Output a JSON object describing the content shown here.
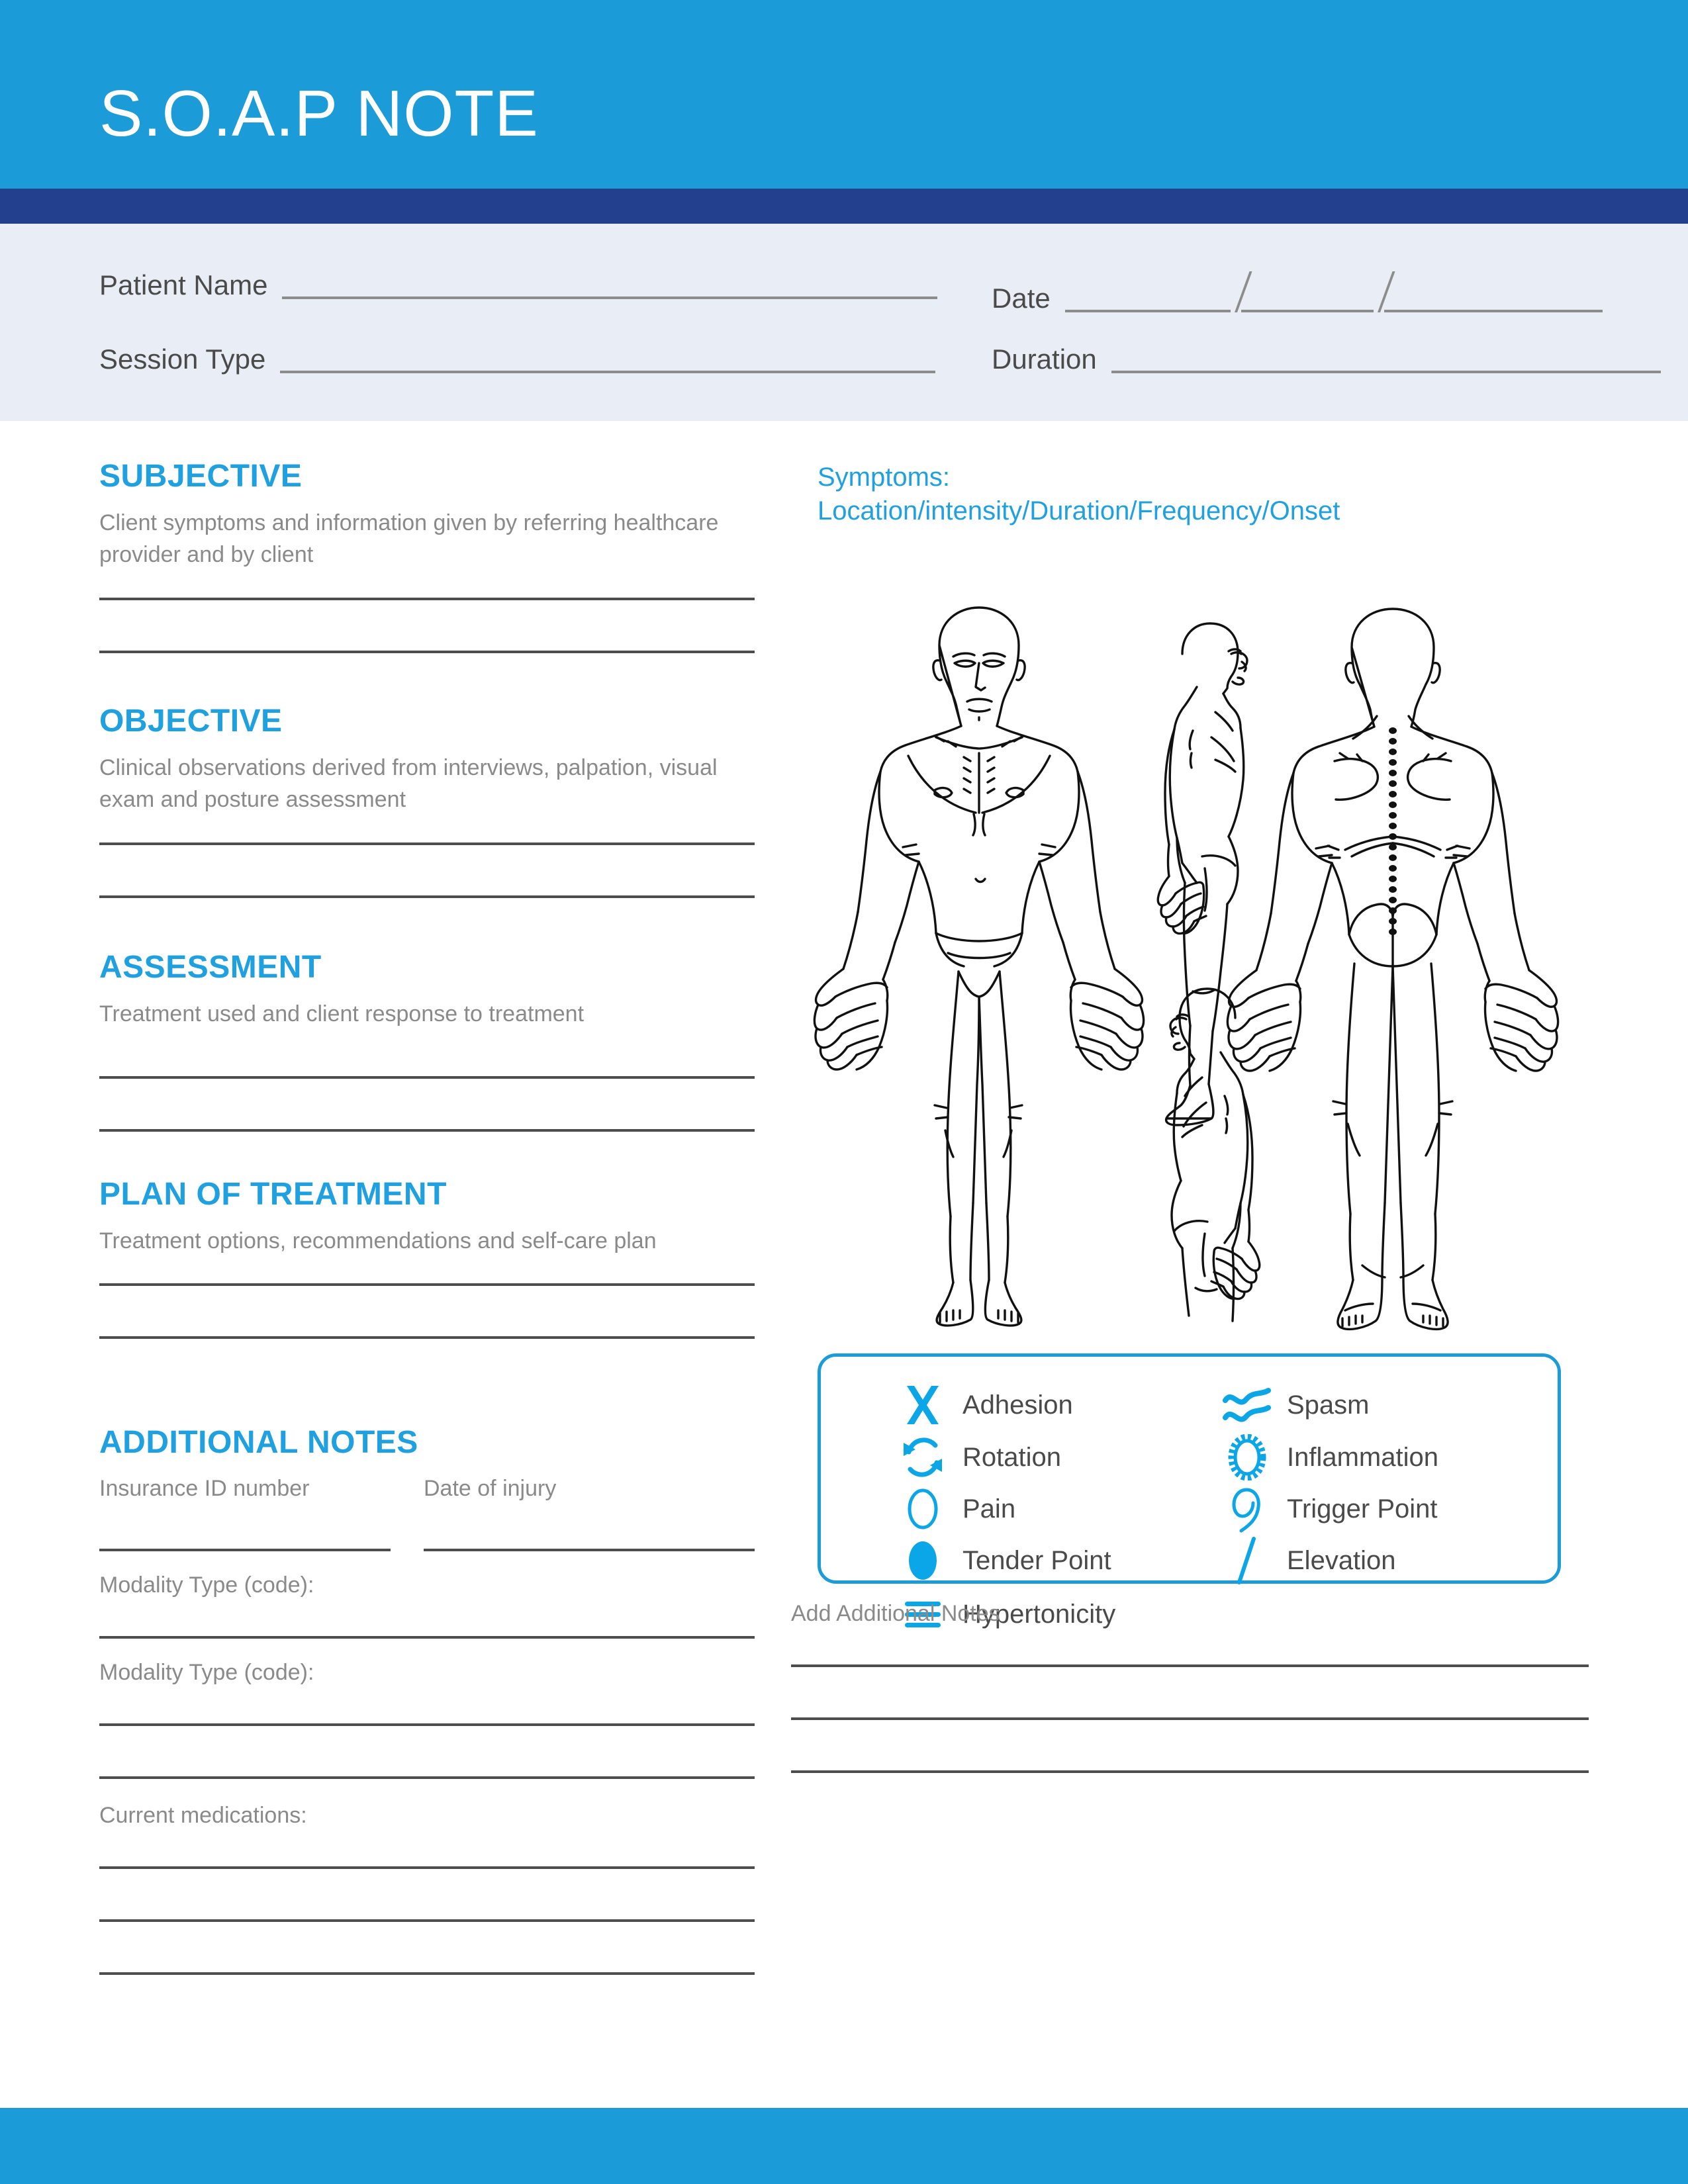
{
  "header": {
    "title": "S.O.A.P NOTE",
    "bar_color": "#1b9bd8",
    "accent_color": "#23408e"
  },
  "patient_info": {
    "background": "#e9edf6",
    "patient_name_label": "Patient Name",
    "date_label": "Date",
    "session_type_label": "Session Type",
    "duration_label": "Duration"
  },
  "left_column": {
    "sections": [
      {
        "heading": "SUBJECTIVE",
        "description": "Client symptoms and information given by referring healthcare provider and by client"
      },
      {
        "heading": "OBJECTIVE",
        "description": "Clinical observations derived from interviews, palpation, visual exam and posture assessment"
      },
      {
        "heading": "ASSESSMENT",
        "description": "Treatment used and client response to treatment"
      },
      {
        "heading": "PLAN OF TREATMENT",
        "description": "Treatment options, recommendations and self-care plan"
      }
    ],
    "additional_notes": {
      "heading": "ADDITIONAL NOTES",
      "insurance_id_label": "Insurance ID number",
      "date_of_injury_label": "Date of injury",
      "modality_type_label_1": "Modality Type (code):",
      "modality_type_label_2": "Modality Type (code):",
      "current_medications_label": "Current medications:"
    }
  },
  "right_column": {
    "symptoms_heading_line1": "Symptoms:",
    "symptoms_heading_line2": "Location/intensity/Duration/Frequency/Onset",
    "body_diagram": {
      "name": "anatomical-body-chart",
      "views": [
        "anterior",
        "lateral-right",
        "lateral-left",
        "posterior"
      ]
    },
    "legend": {
      "border_color": "#1b9bd8",
      "items": [
        {
          "label": "Adhesion",
          "icon": "adhesion-x-icon"
        },
        {
          "label": "Spasm",
          "icon": "spasm-waves-icon"
        },
        {
          "label": "Rotation",
          "icon": "rotation-arrows-icon"
        },
        {
          "label": "Inflammation",
          "icon": "inflammation-starburst-icon"
        },
        {
          "label": "Pain",
          "icon": "pain-open-circle-icon"
        },
        {
          "label": "Trigger Point",
          "icon": "trigger-point-hook-icon"
        },
        {
          "label": "Tender Point",
          "icon": "tender-point-filled-circle-icon"
        },
        {
          "label": "Elevation",
          "icon": "elevation-slash-icon"
        },
        {
          "label": "Hypertonicity",
          "icon": "hypertonicity-bars-icon"
        }
      ]
    },
    "add_additional_notes_label": "Add Additional Notes"
  },
  "colors": {
    "brand_blue": "#1b9bd8",
    "accent_navy": "#23408e",
    "heading_blue": "#1fa0e0",
    "body_gray": "#8a8a8a",
    "line_gray": "#4d4d4d",
    "band_bg": "#e9edf6"
  }
}
